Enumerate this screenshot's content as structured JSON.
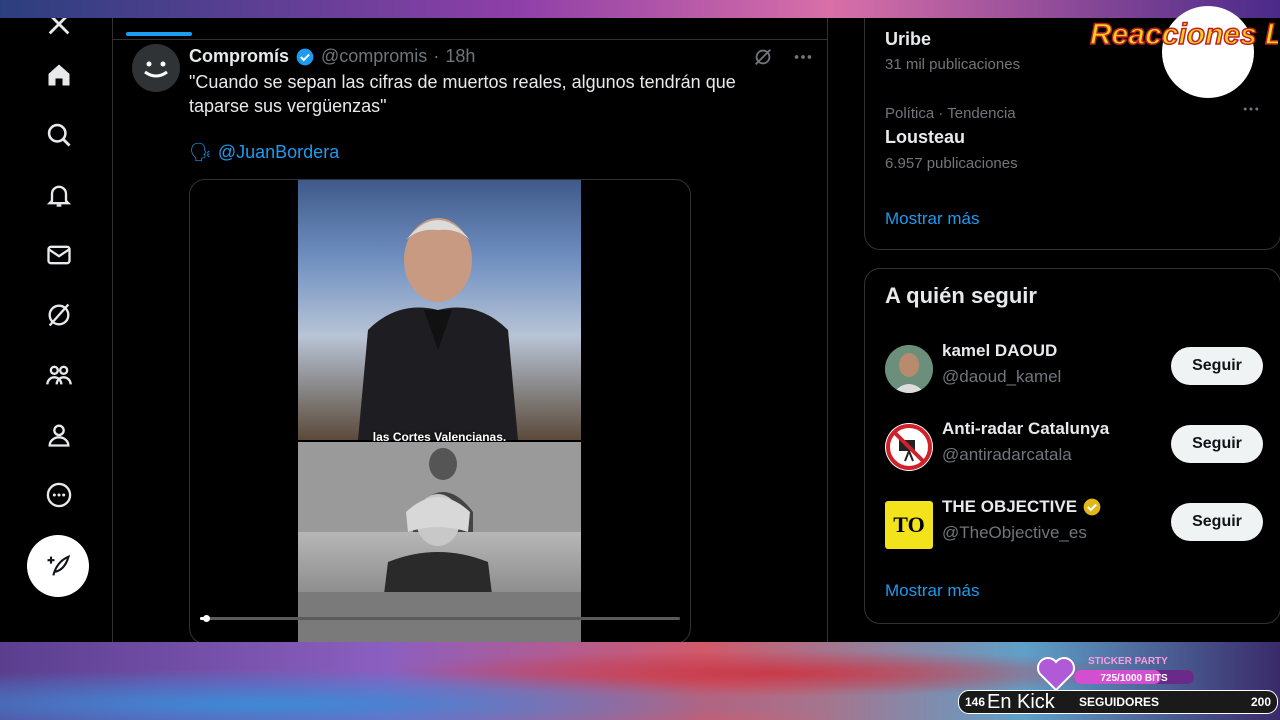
{
  "stream": {
    "logo_text": "Reacciones Locas",
    "sticker_title": "STICKER PARTY",
    "sticker_bits": "725/1000 BITS",
    "sticker_progress": 0.725,
    "followers_current": "146",
    "followers_label": "En Kick",
    "followers_word": "SEGUIDORES",
    "followers_goal": "200"
  },
  "nav": {
    "items": [
      "x-logo",
      "home",
      "search",
      "notifications",
      "messages",
      "grok",
      "communities",
      "profile",
      "more"
    ],
    "compose_label": "Post"
  },
  "tweet": {
    "name": "Compromís",
    "handle": "@compromis",
    "dot": "·",
    "time": "18h",
    "text": "\"Cuando se sepan las cifras de muertos reales, algunos tendrán que taparse sus vergüenzas\"",
    "mention_emoji": "🗣",
    "mention": "@JuanBordera",
    "video_caption": "las Cortes Valencianas.",
    "video_progress": 0.01
  },
  "trends": {
    "partial_name": "Uribe",
    "partial_count": "31 mil publicaciones",
    "item_category": "Política · Tendencia",
    "item_name": "Lousteau",
    "item_count": "6.957 publicaciones",
    "show_more": "Mostrar más"
  },
  "who_to_follow": {
    "title": "A quién seguir",
    "accounts": [
      {
        "name": "kamel DAOUD",
        "handle": "@daoud_kamel",
        "button": "Seguir",
        "verified": false
      },
      {
        "name": "Anti-radar Catalunya",
        "handle": "@antiradarcatala",
        "button": "Seguir",
        "verified": false
      },
      {
        "name": "THE OBJECTIVE",
        "handle": "@TheObjective_es",
        "button": "Seguir",
        "verified": true,
        "avatar_text": "TO"
      }
    ],
    "show_more": "Mostrar más"
  },
  "colors": {
    "accent": "#1d9bf0",
    "background": "#000000",
    "text": "#e7e9ea",
    "muted": "#71767b",
    "gold": "#e2b719"
  }
}
